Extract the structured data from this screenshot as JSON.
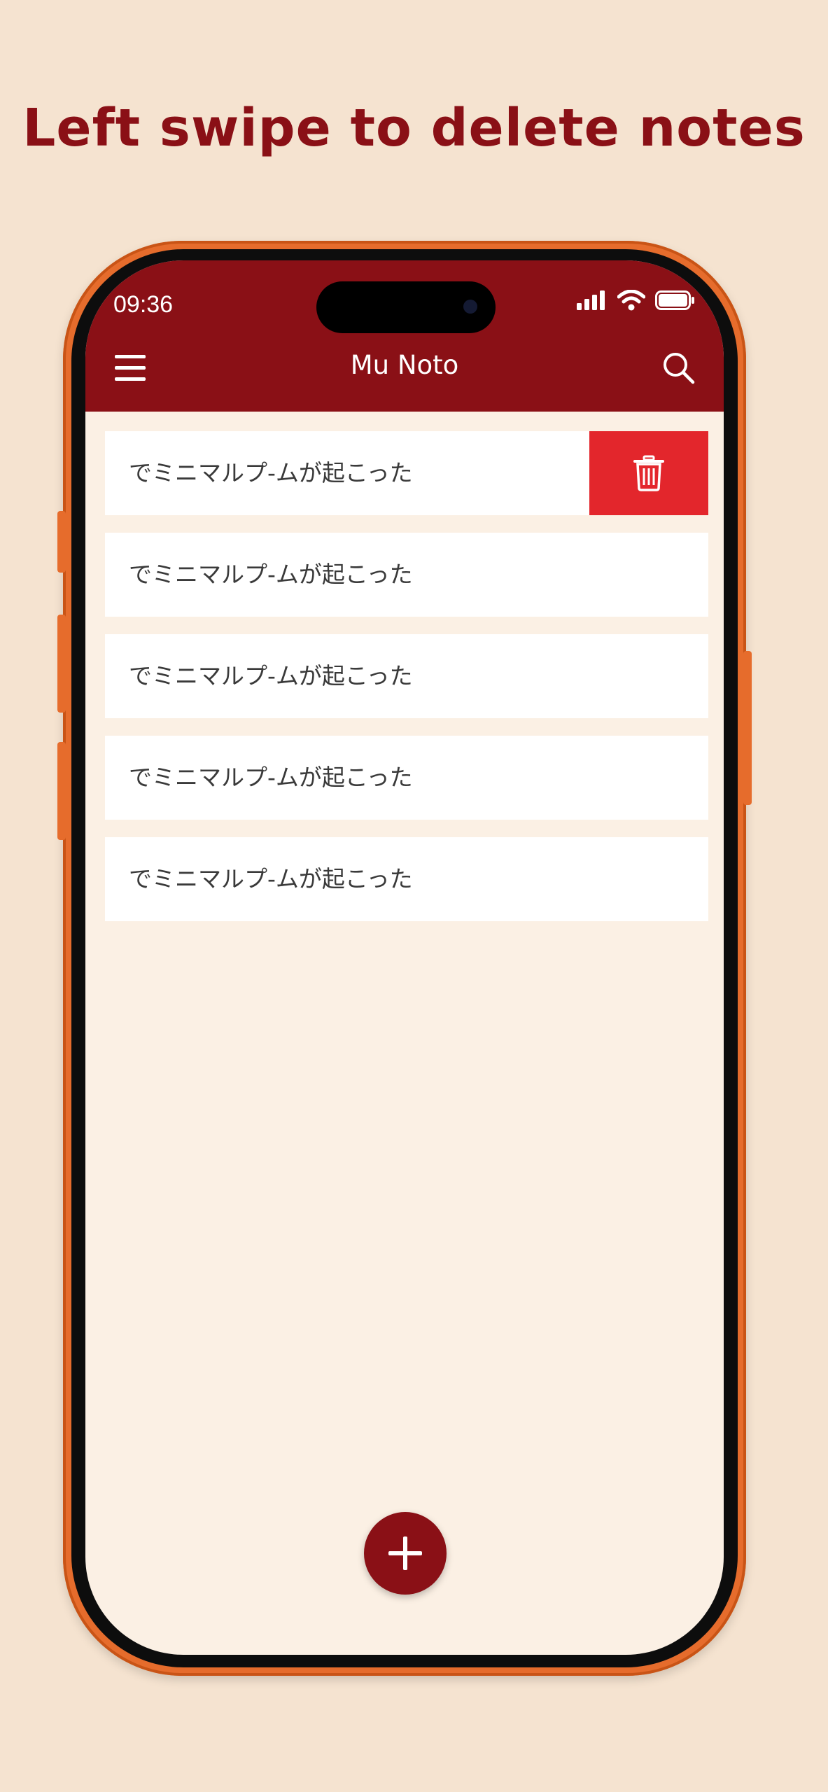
{
  "headline": "Left swipe to delete notes",
  "status_bar": {
    "time": "09:36",
    "icons": [
      "cellular-signal-icon",
      "wifi-icon",
      "battery-icon"
    ]
  },
  "app_bar": {
    "title": "Mu Noto",
    "left_icon": "menu-icon",
    "right_icon": "search-icon"
  },
  "notes": [
    {
      "text": "でミニマルプ-ムが起こった",
      "swiped": true,
      "action_icon": "trash-icon"
    },
    {
      "text": "でミニマルプ-ムが起こった",
      "swiped": false
    },
    {
      "text": "でミニマルプ-ムが起こった",
      "swiped": false
    },
    {
      "text": "でミニマルプ-ムが起こった",
      "swiped": false
    },
    {
      "text": "でミニマルプ-ムが起こった",
      "swiped": false
    }
  ],
  "fab": {
    "icon": "plus-icon"
  },
  "colors": {
    "background": "#f5e3d0",
    "brand": "#8a1016",
    "phone_frame": "#e66c2c",
    "delete": "#e3262c",
    "screen": "#fbf0e4",
    "note_card": "#ffffff",
    "note_text": "#3a3a3a"
  }
}
